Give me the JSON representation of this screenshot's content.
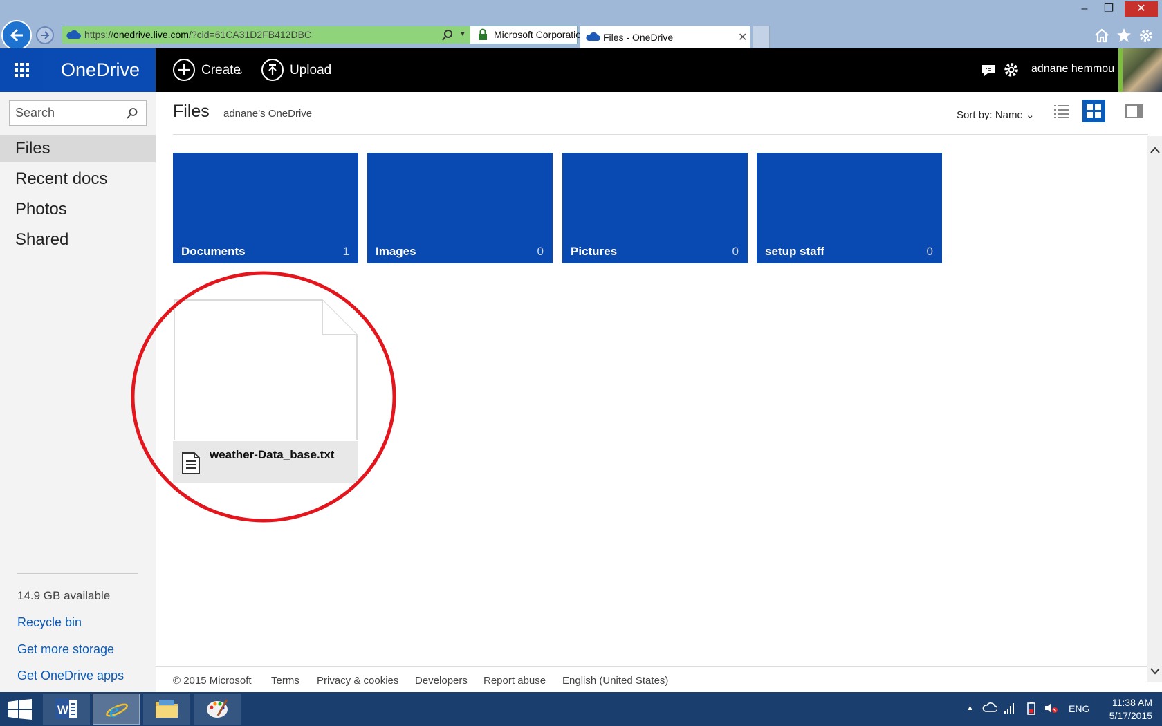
{
  "browser": {
    "url_prefix": "https://",
    "url_domain": "onedrive.live.com",
    "url_rest": "/?cid=61CA31D2FB412DBC",
    "cert": "Microsoft Corporation [US]",
    "tab_title": "Files - OneDrive",
    "window_controls": [
      "minimize-icon",
      "restore-icon",
      "close-icon"
    ]
  },
  "header": {
    "brand": "OneDrive",
    "create_label": "Create",
    "upload_label": "Upload",
    "user_name": "adnane hemmou"
  },
  "sidebar": {
    "search_placeholder": "Search",
    "items": [
      {
        "label": "Files",
        "selected": true
      },
      {
        "label": "Recent docs"
      },
      {
        "label": "Photos"
      },
      {
        "label": "Shared"
      }
    ],
    "storage": "14.9 GB available",
    "links": [
      "Recycle bin",
      "Get more storage",
      "Get OneDrive apps"
    ]
  },
  "main": {
    "title": "Files",
    "subtitle": "adnane’s OneDrive",
    "sort_label": "Sort by: Name",
    "folders": [
      {
        "name": "Documents",
        "count": "1"
      },
      {
        "name": "Images",
        "count": "0"
      },
      {
        "name": "Pictures",
        "count": "0"
      },
      {
        "name": "setup staff",
        "count": "0"
      }
    ],
    "files": [
      {
        "name": "weather-Data_base.txt"
      }
    ]
  },
  "footer": {
    "copyright": "© 2015 Microsoft",
    "links": [
      "Terms",
      "Privacy & cookies",
      "Developers",
      "Report abuse",
      "English (United States)"
    ]
  },
  "taskbar": {
    "lang": "ENG",
    "time": "11:38 AM",
    "date": "5/17/2015"
  },
  "colors": {
    "accent": "#094ab2",
    "annotation": "#e3151d",
    "header_bg": "#000000",
    "taskbar_bg": "#1a3f6f"
  }
}
